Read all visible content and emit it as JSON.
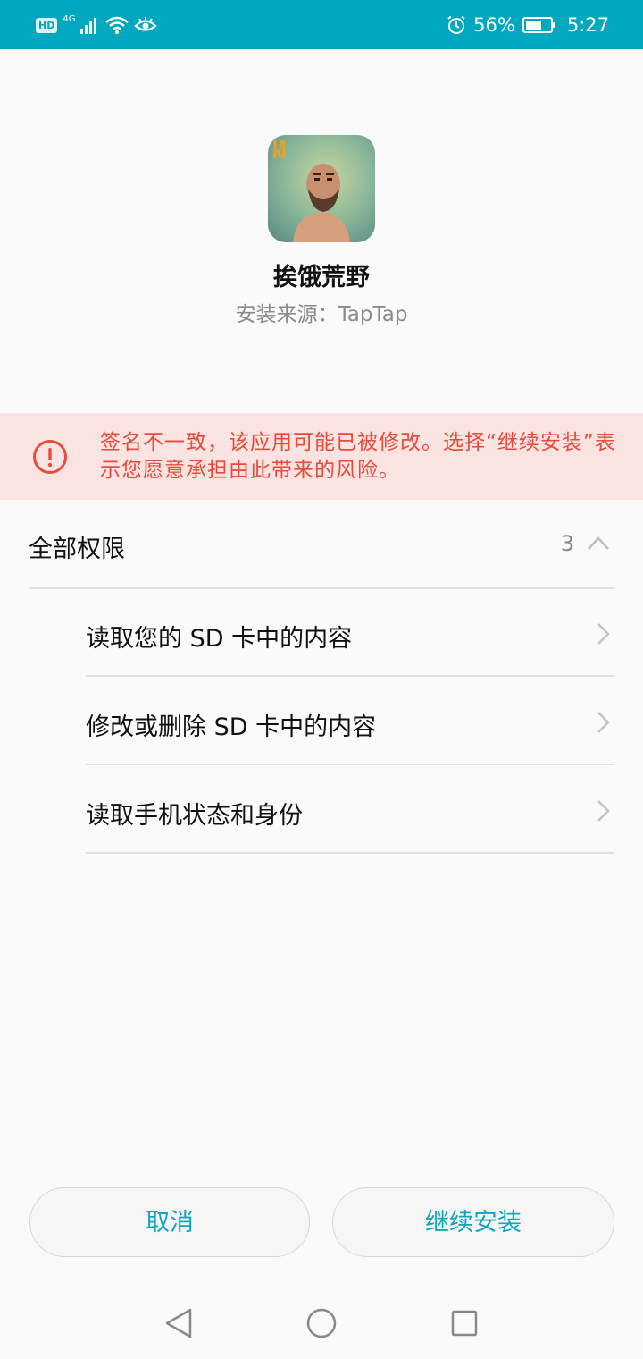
{
  "status_bar": {
    "hd": "HD",
    "network": "4G",
    "battery_percent": "56%",
    "time": "5:27"
  },
  "app": {
    "name": "挨饿荒野",
    "source": "安装来源：TapTap"
  },
  "warning": {
    "text": "签名不一致，该应用可能已被修改。选择“继续安装”表示您愿意承担由此带来的风险。"
  },
  "permissions": {
    "title": "全部权限",
    "count": "3",
    "items": [
      {
        "label": "读取您的 SD 卡中的内容"
      },
      {
        "label": "修改或删除 SD 卡中的内容"
      },
      {
        "label": "读取手机状态和身份"
      }
    ]
  },
  "buttons": {
    "cancel": "取消",
    "install": "继续安装"
  },
  "colors": {
    "status_bar": "#00a8bf",
    "accent": "#11a5ba",
    "warning_bg": "#fbe3e1",
    "warning_text": "#e84a3c"
  },
  "icons": [
    "wifi-icon",
    "signal-icon",
    "eye-icon",
    "alarm-icon",
    "battery-icon",
    "warning-icon",
    "chevron-up-icon",
    "chevron-right-icon",
    "back-icon",
    "home-icon",
    "recent-apps-icon"
  ]
}
